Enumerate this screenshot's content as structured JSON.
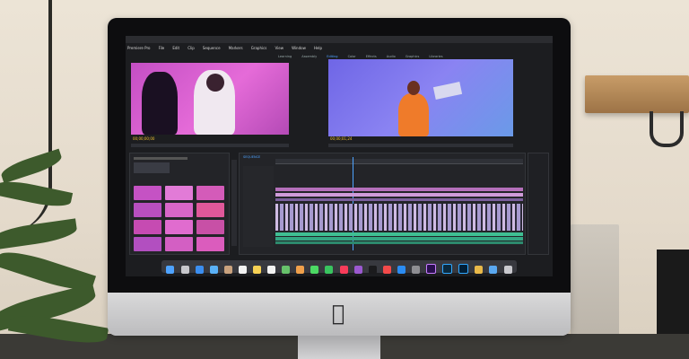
{
  "scene": {
    "colors": {
      "wall": "#e4dacb",
      "imac_bezel": "#0d0d0f",
      "imac_chin": "#cfcfd0",
      "plant": "#3d5a2c",
      "source_monitor": "#d560cf",
      "program_monitor": "#7c7aee",
      "timeline_clip": "#cf9bd9",
      "timeline_audio": "#3fbf93",
      "accent_blue": "#4ea3ff"
    }
  },
  "app": {
    "menu": [
      "Premiere Pro",
      "File",
      "Edit",
      "Clip",
      "Sequence",
      "Markers",
      "Graphics",
      "View",
      "Window",
      "Help"
    ],
    "workspace_tabs": [
      "Learning",
      "Assembly",
      "Editing",
      "Color",
      "Effects",
      "Audio",
      "Graphics",
      "Libraries"
    ],
    "active_workspace": "Editing"
  },
  "source_monitor": {
    "timecode": "00;00;00;00"
  },
  "program_monitor": {
    "timecode": "00;00;01;24"
  },
  "project_panel": {
    "thumbnail_rows": 4,
    "thumbnail_cols": 3
  },
  "timeline": {
    "sequence_tab": "SEQUENCE",
    "video_tracks": 3,
    "audio_tracks": 3
  },
  "dock": {
    "icons": [
      "finder-icon",
      "launchpad-icon",
      "safari-icon",
      "mail-icon",
      "contacts-icon",
      "calendar-icon",
      "notes-icon",
      "reminders-icon",
      "maps-icon",
      "photos-icon",
      "messages-icon",
      "facetime-icon",
      "music-icon",
      "podcasts-icon",
      "tv-icon",
      "news-icon",
      "appstore-icon",
      "settings-icon",
      "premiere-icon",
      "lightroom-icon",
      "photoshop-icon",
      "chrome-icon",
      "folder-icon",
      "trash-icon"
    ]
  }
}
